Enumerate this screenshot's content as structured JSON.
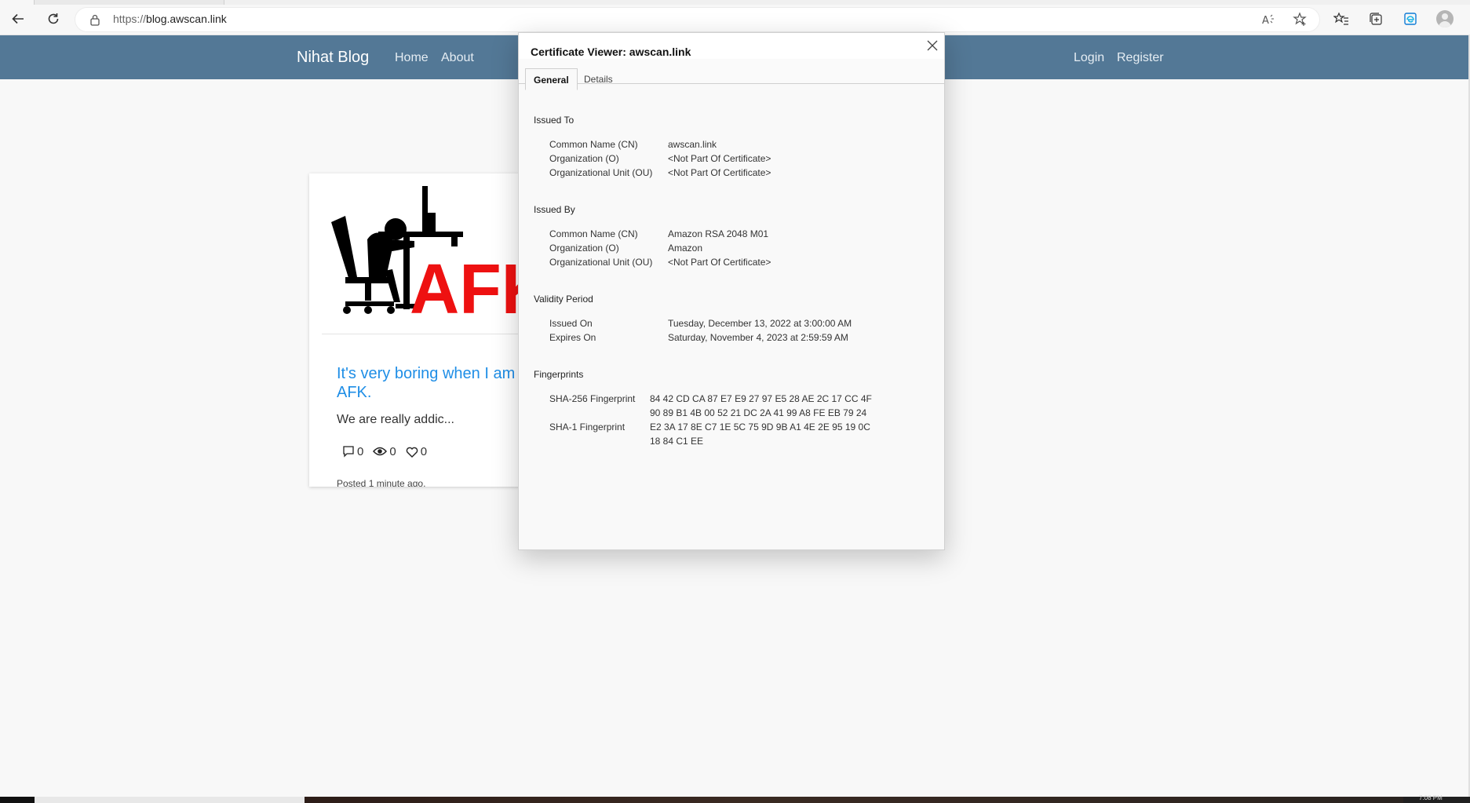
{
  "browser": {
    "url_protocol": "https://",
    "url_host": "blog.awscan.link",
    "clock": "7:08 PM"
  },
  "site": {
    "brand": "Nihat Blog",
    "nav_left": [
      "Home",
      "About"
    ],
    "nav_right": [
      "Login",
      "Register"
    ]
  },
  "post": {
    "image_text": "AFK",
    "title": "It's very boring when I am AFK.",
    "excerpt": "We are really addic...",
    "comments": "0",
    "views": "0",
    "likes": "0",
    "posted": "Posted 1 minute ago."
  },
  "cert": {
    "title": "Certificate Viewer: awscan.link",
    "tabs": [
      "General",
      "Details"
    ],
    "issued_to": {
      "heading": "Issued To",
      "rows": [
        {
          "label": "Common Name (CN)",
          "value": "awscan.link"
        },
        {
          "label": "Organization (O)",
          "value": "<Not Part Of Certificate>"
        },
        {
          "label": "Organizational Unit (OU)",
          "value": "<Not Part Of Certificate>"
        }
      ]
    },
    "issued_by": {
      "heading": "Issued By",
      "rows": [
        {
          "label": "Common Name (CN)",
          "value": "Amazon RSA 2048 M01"
        },
        {
          "label": "Organization (O)",
          "value": "Amazon"
        },
        {
          "label": "Organizational Unit (OU)",
          "value": "<Not Part Of Certificate>"
        }
      ]
    },
    "validity": {
      "heading": "Validity Period",
      "rows": [
        {
          "label": "Issued On",
          "value": "Tuesday, December 13, 2022 at 3:00:00 AM"
        },
        {
          "label": "Expires On",
          "value": "Saturday, November 4, 2023 at 2:59:59 AM"
        }
      ]
    },
    "fingerprints": {
      "heading": "Fingerprints",
      "sha256_label": "SHA-256 Fingerprint",
      "sha256_line1": "84 42 CD CA 87 E7 E9 27 97 E5 28 AE 2C 17 CC 4F",
      "sha256_line2": "90 89 B1 4B 00 52 21 DC 2A 41 99 A8 FE EB 79 24",
      "sha1_label": "SHA-1 Fingerprint",
      "sha1_line1": "E2 3A 17 8E C7 1E 5C 75 9D 9B A1 4E 2E 95 19 0C",
      "sha1_line2": "18 84 C1 EE"
    }
  }
}
